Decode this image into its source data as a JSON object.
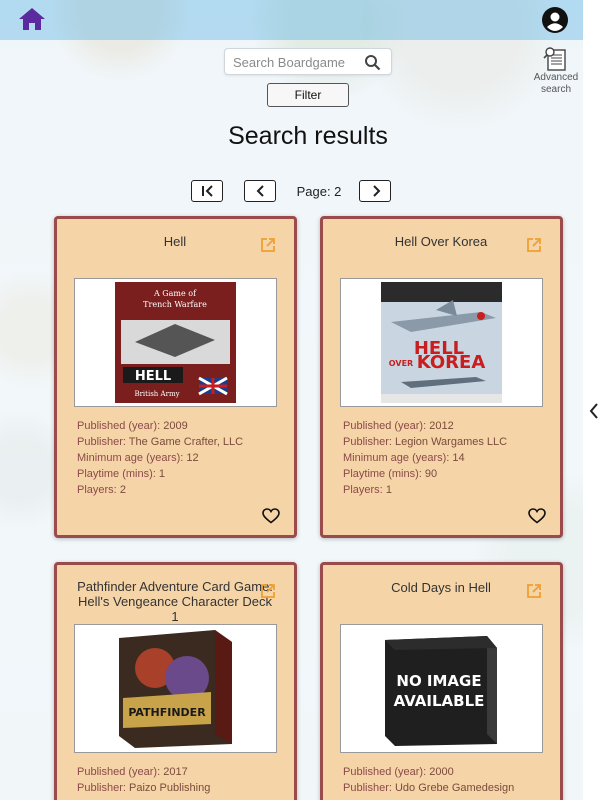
{
  "header": {
    "home_icon": "home-icon",
    "account_icon": "account-circle-icon",
    "accent": "#5b2a9e"
  },
  "search": {
    "placeholder": "Search Boardgame",
    "value": ""
  },
  "advanced_search": {
    "label_line1": "Advanced",
    "label_line2": "search"
  },
  "filter": {
    "label": "Filter"
  },
  "page_title": "Search results",
  "pager": {
    "label": "Page: 2"
  },
  "cards": [
    {
      "title": "Hell",
      "published_label": "Published (year):",
      "published": "2009",
      "publisher_label": "Publisher:",
      "publisher": "The Game Crafter, LLC",
      "min_age_label": "Minimum age (years):",
      "min_age": "12",
      "playtime_label": "Playtime (mins):",
      "playtime": "1",
      "players_label": "Players:",
      "players": "2",
      "box_line1": "A Game of",
      "box_line2": "Trench Warfare",
      "box_line3": "HELL",
      "box_line4": "British Army"
    },
    {
      "title": "Hell Over Korea",
      "published_label": "Published (year):",
      "published": "2012",
      "publisher_label": "Publisher:",
      "publisher": "Legion Wargames LLC",
      "min_age_label": "Minimum age (years):",
      "min_age": "14",
      "playtime_label": "Playtime (mins):",
      "playtime": "90",
      "players_label": "Players:",
      "players": "1",
      "box_line1": "HELL",
      "box_line2": "OVER",
      "box_line3": "KOREA"
    },
    {
      "title": "Pathfinder Adventure Card Game: Hell's Vengeance Character Deck 1",
      "published_label": "Published (year):",
      "published": "2017",
      "publisher_label": "Publisher:",
      "publisher": "Paizo Publishing",
      "box_line1": "PATHFINDER"
    },
    {
      "title": "Cold Days in Hell",
      "published_label": "Published (year):",
      "published": "2000",
      "publisher_label": "Publisher:",
      "publisher": "Udo Grebe Gamedesign",
      "box_line1": "NO IMAGE",
      "box_line2": "AVAILABLE"
    }
  ],
  "colors": {
    "card_bg": "#f5d4a8",
    "card_border": "#9b4b4b",
    "external_link": "#f0a030",
    "label_text": "#8b4a4a"
  }
}
